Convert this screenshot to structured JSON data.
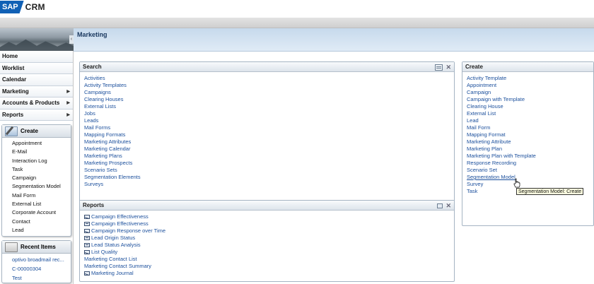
{
  "app": {
    "brand_sap": "SAP",
    "brand_product": "CRM"
  },
  "nav": {
    "items": [
      {
        "label": "Home",
        "has_submenu": false
      },
      {
        "label": "Worklist",
        "has_submenu": false
      },
      {
        "label": "Calendar",
        "has_submenu": false
      },
      {
        "label": "Marketing",
        "has_submenu": true
      },
      {
        "label": "Accounts & Products",
        "has_submenu": true
      },
      {
        "label": "Reports",
        "has_submenu": true
      }
    ],
    "create": {
      "title": "Create",
      "items": [
        "Appointment",
        "E-Mail",
        "Interaction Log",
        "Task",
        "Campaign",
        "Segmentation Model",
        "Mail Form",
        "External List",
        "Corporate Account",
        "Contact",
        "Lead"
      ]
    },
    "recent": {
      "title": "Recent Items",
      "items": [
        "optivo broadmail rec...",
        "C-00000304",
        "Test"
      ]
    }
  },
  "page": {
    "title": "Marketing"
  },
  "search": {
    "title": "Search",
    "links": [
      "Activities",
      "Activity Templates",
      "Campaigns",
      "Clearing Houses",
      "External Lists",
      "Jobs",
      "Leads",
      "Mail Forms",
      "Mapping Formats",
      "Marketing Attributes",
      "Marketing Calendar",
      "Marketing Plans",
      "Marketing Prospects",
      "Scenario Sets",
      "Segmentation Elements",
      "Surveys"
    ]
  },
  "reports": {
    "title": "Reports",
    "links": [
      {
        "label": "Campaign Effectiveness",
        "icon": "mail"
      },
      {
        "label": "Campaign Effectiveness",
        "icon": "grid"
      },
      {
        "label": "Campaign Response over Time",
        "icon": "mail"
      },
      {
        "label": "Lead Origin Status",
        "icon": "grid"
      },
      {
        "label": "Lead Status Analysis",
        "icon": "grid"
      },
      {
        "label": "List Quality",
        "icon": "mail"
      },
      {
        "label": "Marketing Contact List",
        "icon": ""
      },
      {
        "label": "Marketing Contact Summary",
        "icon": ""
      },
      {
        "label": "Marketing Journal",
        "icon": "mail"
      }
    ]
  },
  "create_block": {
    "title": "Create",
    "links": [
      "Activity Template",
      "Appointment",
      "Campaign",
      "Campaign with Template",
      "Clearing House",
      "External List",
      "Lead",
      "Mail Form",
      "Mapping Format",
      "Marketing Attribute",
      "Marketing Plan",
      "Marketing Plan with Template",
      "Response Recording",
      "Scenario Set",
      "Segmentation Model",
      "Survey",
      "Task"
    ],
    "hovered_index": 14
  },
  "tooltip": {
    "text": "Segmentation Model: Create"
  },
  "colors": {
    "link": "#1b4f9c",
    "header_blue": "#c6d9ec",
    "sap_blue": "#1060b5"
  }
}
